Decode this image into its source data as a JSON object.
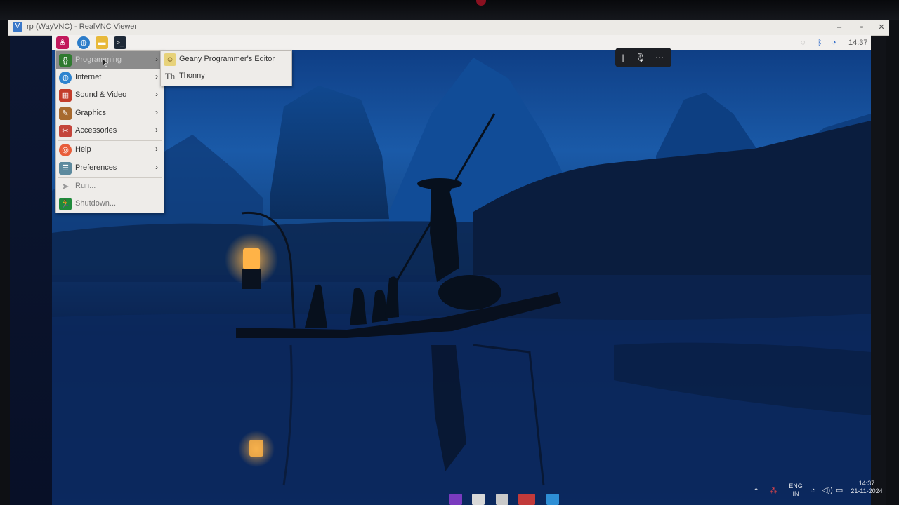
{
  "vnc_window": {
    "title": "rp (WayVNC) - RealVNC Viewer",
    "controls": [
      "–",
      "▫",
      "✕"
    ]
  },
  "rpi_panel": {
    "launchers": [
      "raspberry-menu-icon",
      "browser-icon",
      "file-manager-icon",
      "terminal-icon"
    ],
    "tray": {
      "clock": "14:37"
    }
  },
  "main_menu": {
    "items": [
      {
        "label": "Programming",
        "icon": "programming-icon",
        "submenu": true,
        "active": true
      },
      {
        "label": "Internet",
        "icon": "internet-globe-icon",
        "submenu": true
      },
      {
        "label": "Sound & Video",
        "icon": "sound-video-icon",
        "submenu": true
      },
      {
        "label": "Graphics",
        "icon": "graphics-brush-icon",
        "submenu": true
      },
      {
        "label": "Accessories",
        "icon": "accessories-icon",
        "submenu": true
      },
      {
        "label": "Help",
        "icon": "help-lifebuoy-icon",
        "submenu": true
      },
      {
        "label": "Preferences",
        "icon": "preferences-icon",
        "submenu": true
      },
      {
        "label": "Run...",
        "icon": "run-paper-plane-icon",
        "submenu": false
      },
      {
        "label": "Shutdown...",
        "icon": "shutdown-running-man-icon",
        "submenu": false
      }
    ]
  },
  "programming_submenu": {
    "items": [
      {
        "label": "Geany Programmer's Editor",
        "icon": "geany-icon"
      },
      {
        "label": "Thonny",
        "icon": "thonny-icon"
      }
    ]
  },
  "vnc_toolbar": {
    "buttons": [
      "text-cursor-icon",
      "microphone-icon",
      "more-options-icon"
    ]
  },
  "windows_taskbar": {
    "language": "ENG",
    "region": "IN",
    "time": "14:37",
    "date": "21-11-2024"
  },
  "colors": {
    "panel_bg": "#f2f0ee",
    "menu_bg": "#eeece9",
    "menu_active": "#8b8b8b",
    "desktop_blue": "#1a5aa8",
    "lantern": "#ffb347"
  }
}
